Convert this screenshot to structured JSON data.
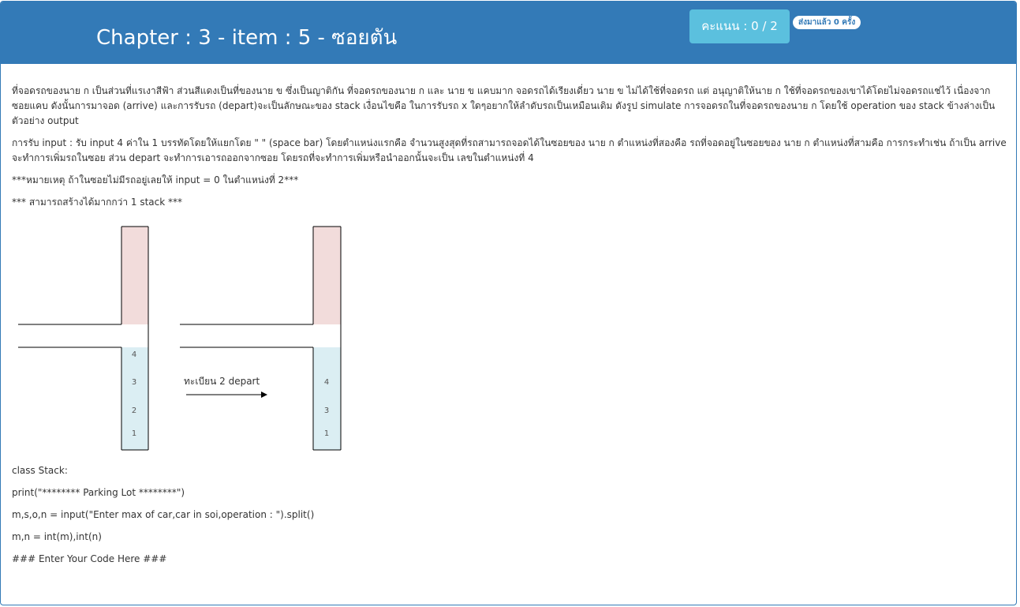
{
  "header": {
    "title": "Chapter : 3 - item : 5 - ซอยตัน",
    "score": "คะแนน : 0 / 2",
    "submissions": "ส่งมาแล้ว 0 ครั้ง"
  },
  "description": {
    "para1": "ที่จอดรถของนาย ก เป็นส่วนที่แรเงาสีฟ้า ส่วนสีแดงเป็นที่ของนาย ข ซึ่งเป็นญาติกัน ที่จอดรถของนาย ก และ นาย ข แคบมาก จอดรถได้เรียงเดี่ยว นาย ข ไม่ได้ใช้ที่จอดรถ แต่ อนุญาติให้นาย ก ใช้ที่จอดรถของเขาได้โดยไม่จอดรถแช่ไว้ เนื่องจากซอยแคบ ดังนั้นการมาจอด (arrive) และการรับรถ (depart)จะเป็นลักษณะของ stack เงื่อนไขคือ ในการรับรถ x ใดๆอยากให้ลำดับรถเป็นเหมือนเดิม ดังรูป simulate การจอดรถในที่จอดรถของนาย ก โดยใช้ operation ของ stack ข้างล่างเป็นตัวอย่าง output",
    "para2": "การรับ input : รับ input 4 ค่าใน 1 บรรทัดโดยให้แยกโดย \" \" (space bar) โดยตำแหน่งแรกคือ จำนวนสูงสุดที่รถสามารถจอดได้ในซอยของ นาย ก ตำแหน่งที่สองคือ รถที่จอดอยู่ในซอยของ นาย ก ตำแหน่งที่สามคือ การกระทำเช่น ถ้าเป็น arrive จะทำการเพิ่มรถในซอย ส่วน depart จะทำการเอารถออกจากซอย โดยรถที่จะทำการเพิ่มหรือนำออกนั้นจะเป็น เลขในตำแหน่งที่ 4",
    "note1": "***หมายเหตุ ถ้าในซอยไม่มีรถอยู่เลยให้ input = 0 ในตำแหน่งที่ 2***",
    "note2": "*** สามารถสร้างได้มากกว่า 1 stack ***"
  },
  "diagram": {
    "left_stack": [
      "4",
      "3",
      "2",
      "1"
    ],
    "right_stack": [
      "4",
      "3",
      "1"
    ],
    "arrow_label": "ทะเบียน 2 depart",
    "colors": {
      "red_area": "#f2dcdb",
      "blue_area": "#dbeef3"
    }
  },
  "code": {
    "line1": "class Stack:",
    "line2": "print(\"******** Parking Lot ********\")",
    "line3": "m,s,o,n = input(\"Enter max of car,car in soi,operation : \").split()",
    "line4": "m,n = int(m),int(n)",
    "line5": "### Enter Your Code Here ###"
  }
}
